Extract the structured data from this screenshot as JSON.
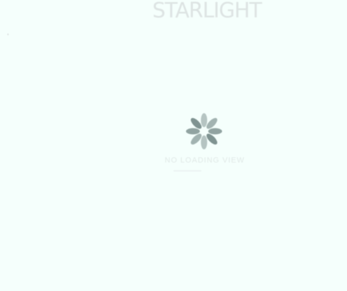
{
  "app": {
    "title": "STARLIGHT"
  },
  "loading": {
    "status": "NO LOADING VIEW",
    "spinner_color": "#7f9391"
  }
}
